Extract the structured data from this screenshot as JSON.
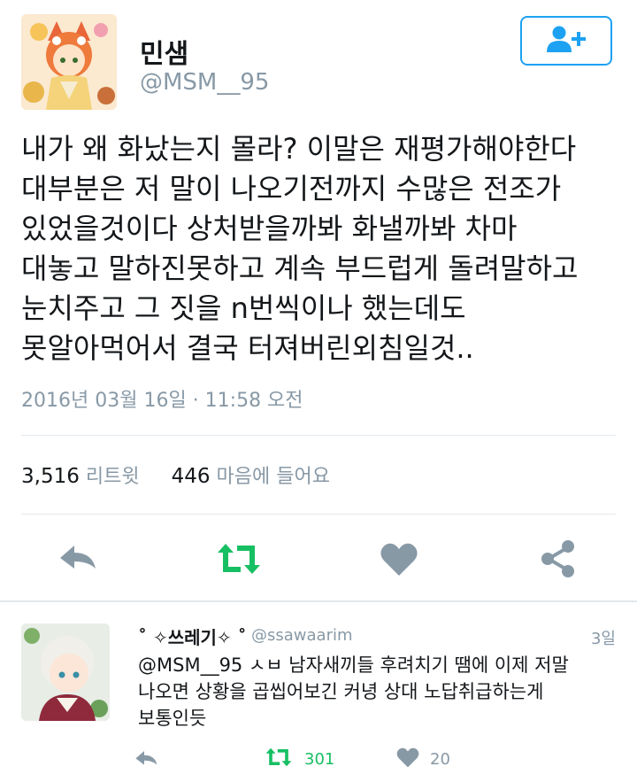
{
  "user": {
    "name": "민샘",
    "handle": "@MSM__95"
  },
  "tweet": {
    "text": "내가 왜 화났는지 몰라? 이말은 재평가해야한다\n대부분은 저 말이 나오기전까지 수많은 전조가\n있었을것이다 상처받을까봐 화낼까봐 차마\n대놓고 말하진못하고 계속 부드럽게 돌려말하고\n눈치주고 그 짓을 n번씩이나 했는데도\n못알아먹어서 결국 터져버린외침일것..",
    "timestamp": "2016년 03월 16일 · 11:58 오전"
  },
  "stats": {
    "retweets_count": "3,516",
    "retweets_label": "리트윗",
    "likes_count": "446",
    "likes_label": "마음에 들어요"
  },
  "reply": {
    "name": "˚ ✧쓰레기✧ ˚",
    "handle": "@ssawaarim",
    "time": "3일",
    "text": "@MSM__95 ㅅㅂ 남자새끼들 후려치기 땜에 이제 저말\n나오면 상황을 곱씹어보긴 커녕 상대 노답취급하는게\n보통인듯",
    "retweet_count": "301",
    "like_count": "20"
  },
  "colors": {
    "accent": "#1da1f2",
    "retweet_green": "#17bf63",
    "icon_gray": "#8899a6",
    "text": "#14171a"
  },
  "icons": [
    "follow-user-icon",
    "reply-icon",
    "retweet-icon",
    "heart-icon",
    "share-icon"
  ]
}
